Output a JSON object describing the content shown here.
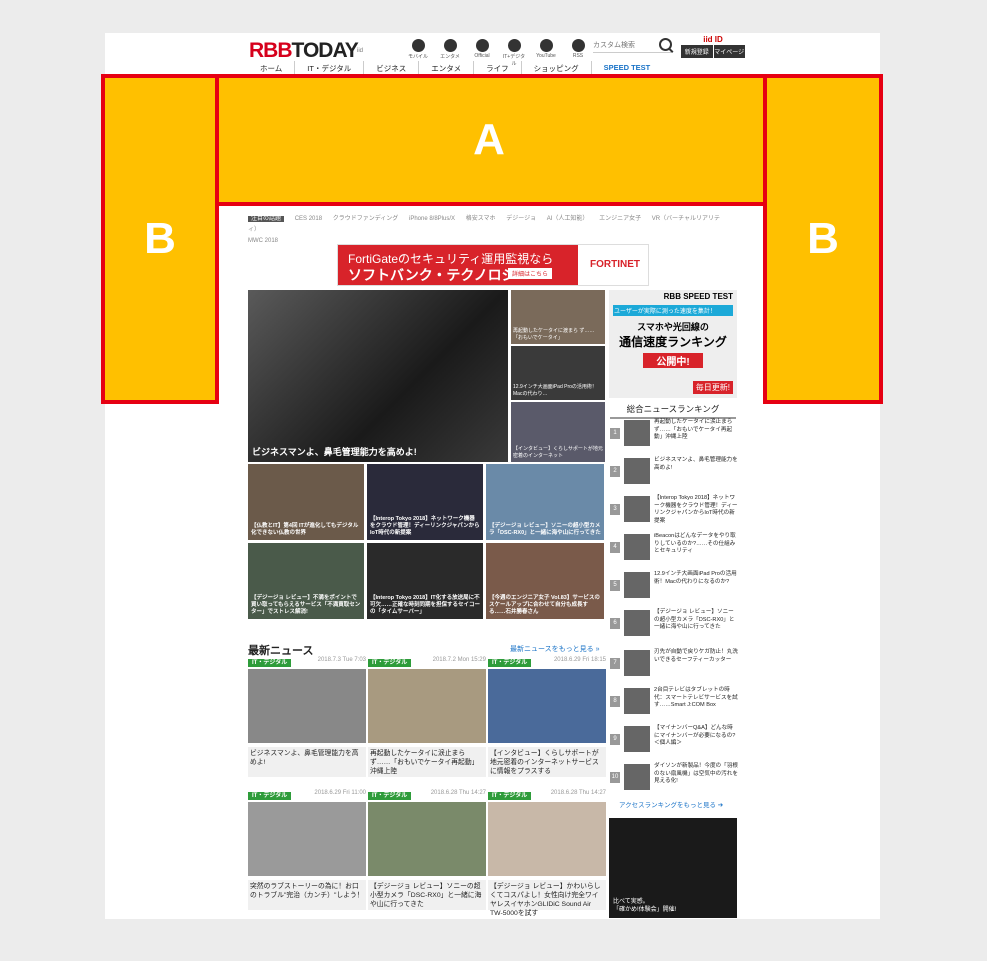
{
  "header": {
    "logo": "RBBTODAY",
    "logo_sub": "iid",
    "social": [
      "モバイル",
      "エンタメ",
      "Official",
      "IT+デジタル",
      "YouTube",
      "RSS"
    ],
    "search_placeholder": "カスタム検索",
    "id_logo": "iid ID",
    "id_register": "新規登録",
    "id_mypage": "マイページ"
  },
  "nav": [
    "ホーム",
    "IT・デジタル",
    "ビジネス",
    "エンタメ",
    "ライフ",
    "ショッピング",
    "SPEED TEST"
  ],
  "overlays": {
    "a": "A",
    "b": "B"
  },
  "tags": [
    "注目の話題",
    "CES 2018",
    "クラウドファンディング",
    "iPhone 8/8Plus/X",
    "格安スマホ",
    "デジージョ",
    "AI（人工知能）",
    "エンジニア女子",
    "VR（バーチャルリアリティ）",
    "MWC 2018"
  ],
  "banner": {
    "line1": "FortiGateのセキュリティ運用監視なら",
    "line2": "ソフトバンク・テクノロジー",
    "cta": "詳細はこちら",
    "brand": "FORTINET"
  },
  "hero": {
    "caption": "ビジネスマンよ、鼻毛管理能力を高めよ!"
  },
  "side_thumbs": [
    "再起動したケータイに渡まら ず……「おもいでケータイ」",
    "12.9インチ大画面iPad Proの活用術！Macの代わり…",
    "【インタビュー】くらしサポートが地元密着のインターネット"
  ],
  "grid": [
    "【仏教とIT】第4回 ITが進化してもデジタル化できない仏教の世界",
    "【Interop Tokyo 2018】ネットワーク機器をクラウド管理！ディーリンクジャパンからIoT時代の新提案",
    "【デジージョ レビュー】ソニーの超小型カメラ「DSC-RX0」と一緒に海や山に行ってきた",
    "【デジージョ レビュー】不満をポイントで買い取ってもらえるサービス「不満買取センター」でストレス解消!",
    "【Interop Tokyo 2018】IT化する放送局に不可欠……正確な時刻同期を担保するセイコーの「タイムサーバー」",
    "【今週のエンジニア女子 Vol.83】サービスのスケールアップに合わせて自分も成長する……石井勝春さん"
  ],
  "latest": {
    "title": "最新ニュース",
    "more": "最新ニュースをもっと見る »",
    "cards": [
      {
        "cat": "IT・デジタル",
        "date": "2018.7.3 Tue 7:03",
        "text": "ビジネスマンよ、鼻毛管理能力を高めよ!"
      },
      {
        "cat": "IT・デジタル",
        "date": "2018.7.2 Mon 15:29",
        "text": "再起動したケータイに涙止まらず……「おもいでケータイ再起動」沖縄上陸"
      },
      {
        "cat": "IT・デジタル",
        "date": "2018.6.29 Fri 18:15",
        "text": "【インタビュー】くらしサポートが地元密着のインターネットサービスに情報をプラスする"
      },
      {
        "cat": "IT・デジタル",
        "date": "2018.6.29 Fri 11:00",
        "text": "突然のラブストーリーの為に！お口のトラブル\"完治（カンチ）\"しよう！"
      },
      {
        "cat": "IT・デジタル",
        "date": "2018.6.28 Thu 14:27",
        "text": "【デジージョ レビュー】ソニーの超小型カメラ「DSC-RX0」と一緒に海や山に行ってきた"
      },
      {
        "cat": "IT・デジタル",
        "date": "2018.6.28 Thu 14:27",
        "text": "【デジージョ レビュー】かわいらしくてコスパよし！女性向け完全ワイヤレスイヤホンGLIDiC Sound Air TW-5000を試す"
      }
    ]
  },
  "speedtest": {
    "t1": "RBB SPEED TEST",
    "t2": "ユーザーが実際に測った速度を集計！",
    "t3": "スマホや光回線の",
    "t4": "通信速度ランキング",
    "t5": "公開中!",
    "t6": "毎日更新!"
  },
  "ranking": {
    "title": "総合ニュースランキング",
    "items": [
      {
        "num": "1",
        "text": "再起動したケータイに涙止まらず……「おもいでケータイ再起動」沖縄上陸"
      },
      {
        "num": "2",
        "text": "ビジネスマンよ、鼻毛管理能力を高めよ!"
      },
      {
        "num": "3",
        "text": "【Interop Tokyo 2018】ネットワーク機器をクラウド管理！ディーリンクジャパンからIoT時代の新提案"
      },
      {
        "num": "4",
        "text": "iBeaconはどんなデータをやり取りしているのか?……その仕組みとセキュリティ"
      },
      {
        "num": "5",
        "text": "12.9インチ大画面iPad Proの活用術！Macの代わりになるのか?"
      },
      {
        "num": "6",
        "text": "【デジージョ レビュー】ソニーの超小型カメラ「DSC-RX0」と一緒に海や山に行ってきた"
      },
      {
        "num": "7",
        "text": "刃先が自動で戻りケガ防止！丸洗いできるセーフティーカッター"
      },
      {
        "num": "8",
        "text": "2台目テレビはタブレットの時代：スマートテレビサービスを試す……Smart J:COM Box"
      },
      {
        "num": "9",
        "text": "【マイナンバーQ&A】どんな時にマイナンバーが必要になるの?＜個人編＞"
      },
      {
        "num": "10",
        "text": "ダイソンが新製品！今度の「羽根のない扇風機」は空気中の汚れを見える化!"
      }
    ],
    "more": "アクセスランキングをもっと見る ➔"
  },
  "ad2": {
    "line1": "比べて実感。",
    "line2": "「確かめ!体験会」開催!"
  }
}
